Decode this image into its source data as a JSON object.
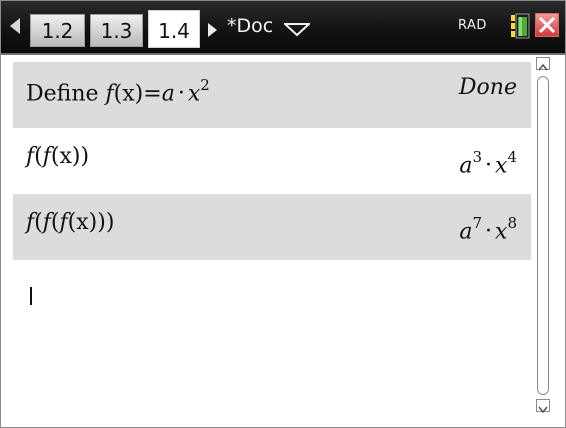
{
  "tabs": [
    {
      "label": "1.2",
      "active": false
    },
    {
      "label": "1.3",
      "active": false
    },
    {
      "label": "1.4",
      "active": true
    }
  ],
  "document": {
    "name": "*Doc"
  },
  "status": {
    "angle_mode": "RAD"
  },
  "colors": {
    "close": "#d34040",
    "battery": "#4caa3a",
    "row_shade": "#dcdcdc",
    "topbar": "#111111"
  },
  "history": [
    {
      "input": {
        "prefix": "Define ",
        "fn": "f",
        "arg": "(x)",
        "eq": "=",
        "a": "a",
        "dot": "·",
        "x": "x",
        "exp": "2"
      },
      "output": {
        "text": "Done"
      }
    },
    {
      "input": {
        "outer_f": "f",
        "inner_f": "f",
        "arg": "(x))",
        "open": "("
      },
      "output": {
        "a": "a",
        "a_exp": "3",
        "dot": "·",
        "x": "x",
        "x_exp": "4"
      }
    },
    {
      "input": {
        "f1": "f",
        "f2": "f",
        "f3": "f",
        "open": "(",
        "arg": "(x)))"
      },
      "output": {
        "a": "a",
        "a_exp": "7",
        "dot": "·",
        "x": "x",
        "x_exp": "8"
      }
    }
  ],
  "icons": {
    "left": "arrow-left-icon",
    "right": "arrow-right-icon",
    "doc_menu": "chevron-down-icon",
    "battery": "battery-icon",
    "close": "close-icon"
  }
}
